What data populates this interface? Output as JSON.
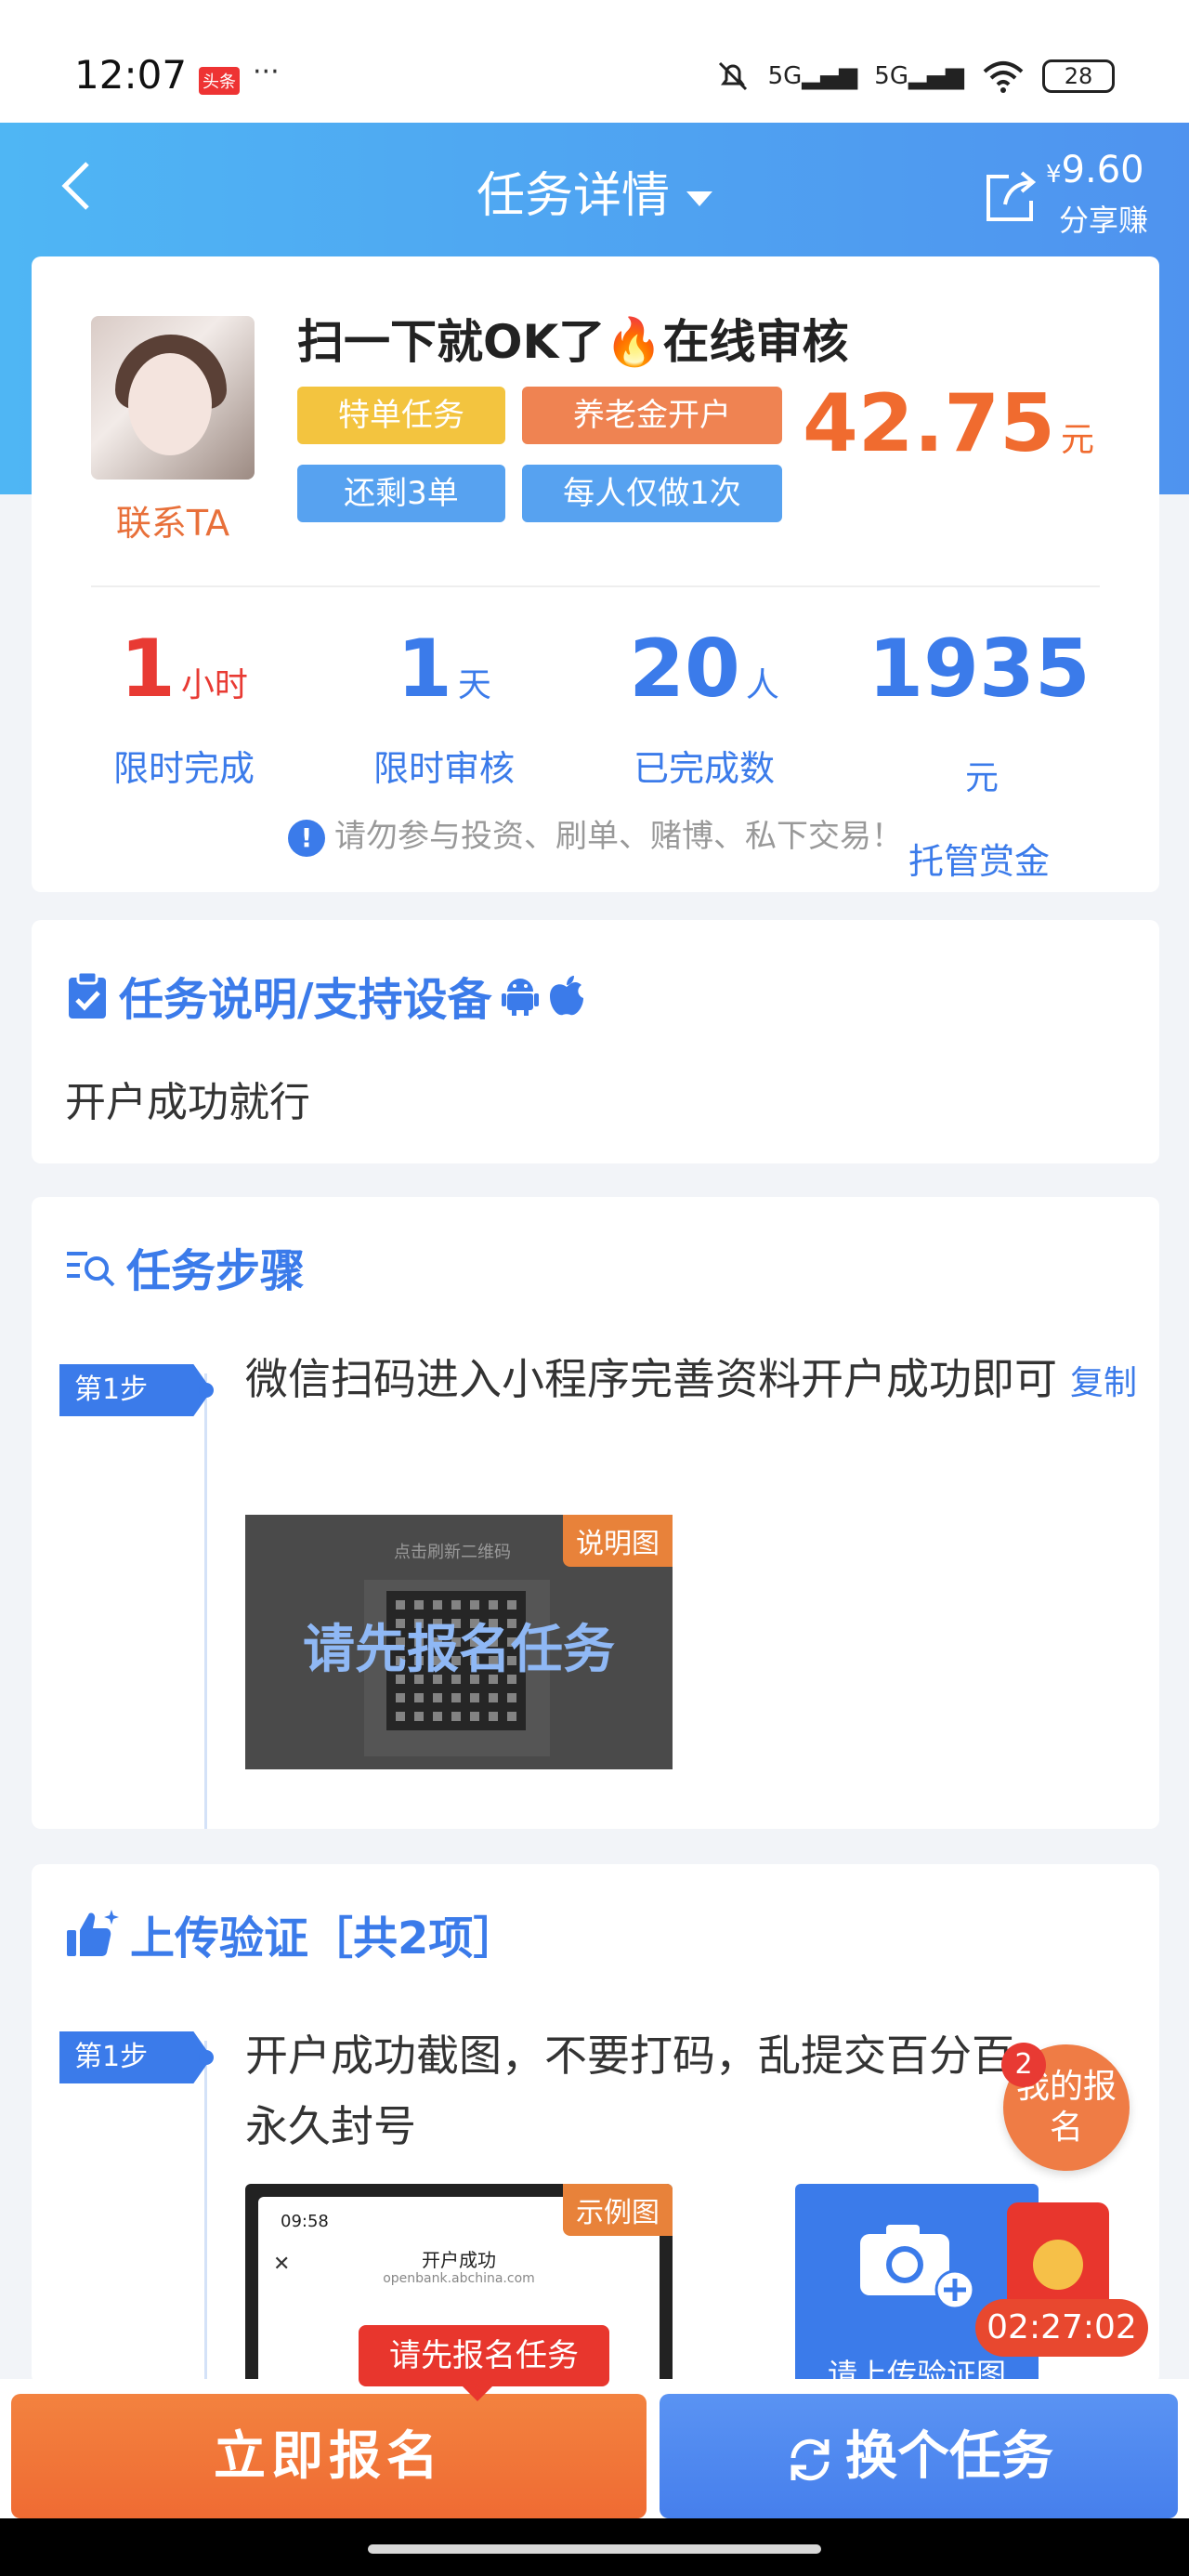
{
  "status": {
    "time": "12:07",
    "news_badge": "头条",
    "dots": "···",
    "signal1": "5G",
    "signal2": "5G",
    "battery": "28"
  },
  "nav": {
    "title": "任务详情",
    "share_amount": "9.60",
    "share_currency": "¥",
    "share_label": "分享赚"
  },
  "task": {
    "title": "扫一下就OK了🔥在线审核",
    "contact": "联系TA",
    "tags": [
      "特单任务",
      "养老金开户",
      "还剩3单",
      "每人仅做1次"
    ],
    "reward": "42.75",
    "reward_unit": "元"
  },
  "stats": [
    {
      "num": "1",
      "unit": "小时",
      "label": "限时完成"
    },
    {
      "num": "1",
      "unit": "天",
      "label": "限时审核"
    },
    {
      "num": "20",
      "unit": "人",
      "label": "已完成数"
    },
    {
      "num": "1935",
      "unit": "元",
      "label": "托管赏金"
    }
  ],
  "warning": "请勿参与投资、刷单、赌博、私下交易！",
  "desc": {
    "title": "任务说明/支持设备",
    "text": "开户成功就行"
  },
  "steps": {
    "title": "任务步骤",
    "step1_badge": "第1步",
    "step1_text": "微信扫码进入小程序完善资料开户成功即可",
    "copy": "复制",
    "img_caption": "点击刷新二维码",
    "img_badge": "说明图",
    "overlay": "请先报名任务"
  },
  "upload": {
    "title": "上传验证［共2项］",
    "step1_badge": "第1步",
    "step1_text": "开户成功截图，不要打码，乱提交百分百永久封号",
    "img_badge": "示例图",
    "proof_time": "09:58",
    "proof_title": "开户成功",
    "proof_url": "openbank.abchina.com",
    "upload_label": "请上传验证图"
  },
  "floating": {
    "count": "2",
    "label": "我的报名",
    "timer": "02:27:02",
    "tooltip": "请先报名任务"
  },
  "buttons": {
    "signup": "立即报名",
    "switch": "换个任务"
  }
}
